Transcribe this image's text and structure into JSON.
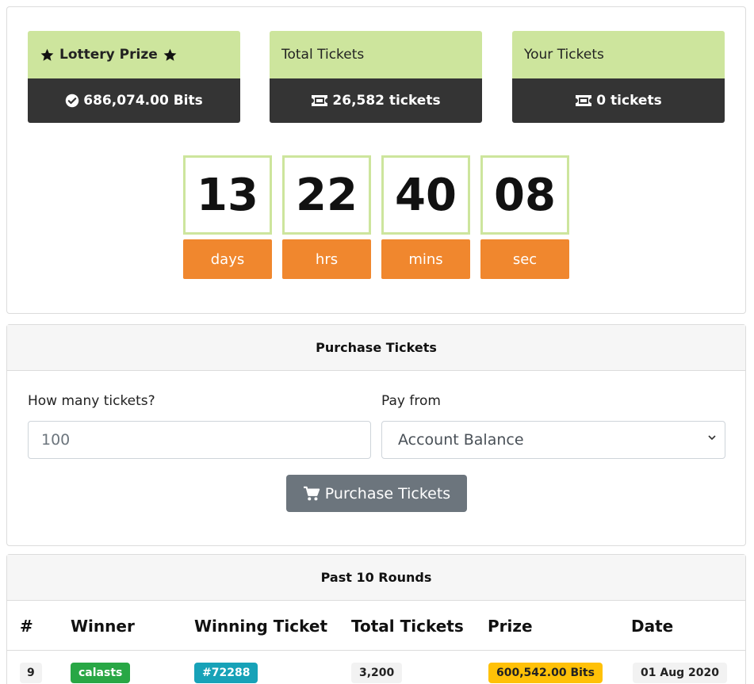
{
  "stats": {
    "lottery_prize": {
      "title": "Lottery Prize",
      "value": "686,074.00 Bits"
    },
    "total_tickets": {
      "title": "Total Tickets",
      "value": "26,582 tickets"
    },
    "your_tickets": {
      "title": "Your Tickets",
      "value": "0 tickets"
    }
  },
  "countdown": [
    {
      "value": "13",
      "label": "days"
    },
    {
      "value": "22",
      "label": "hrs"
    },
    {
      "value": "40",
      "label": "mins"
    },
    {
      "value": "08",
      "label": "sec"
    }
  ],
  "purchase": {
    "title": "Purchase Tickets",
    "quantity_label": "How many tickets?",
    "quantity_placeholder": "100",
    "pay_from_label": "Pay from",
    "pay_from_selected": "Account Balance",
    "button_label": "Purchase Tickets"
  },
  "rounds": {
    "title": "Past 10 Rounds",
    "headers": [
      "#",
      "Winner",
      "Winning Ticket",
      "Total Tickets",
      "Prize",
      "Date"
    ],
    "rows": [
      {
        "round": "9",
        "winner": "calasts",
        "ticket": "#72288",
        "total": "3,200",
        "prize": "600,542.00 Bits",
        "date": "01 Aug 2020"
      }
    ]
  },
  "colors": {
    "stat_header": "#cde59d",
    "stat_body": "#343434",
    "countdown_border": "#cde59d",
    "countdown_label": "#f0872e",
    "button": "#6c757d",
    "winner_badge": "#28a745",
    "ticket_badge": "#17a2b8",
    "prize_badge": "#ffc107",
    "neutral_badge": "#f2f2f2"
  },
  "icons": [
    "star-icon",
    "check-circle-icon",
    "ticket-icon",
    "cart-icon",
    "chevron-down-icon"
  ]
}
